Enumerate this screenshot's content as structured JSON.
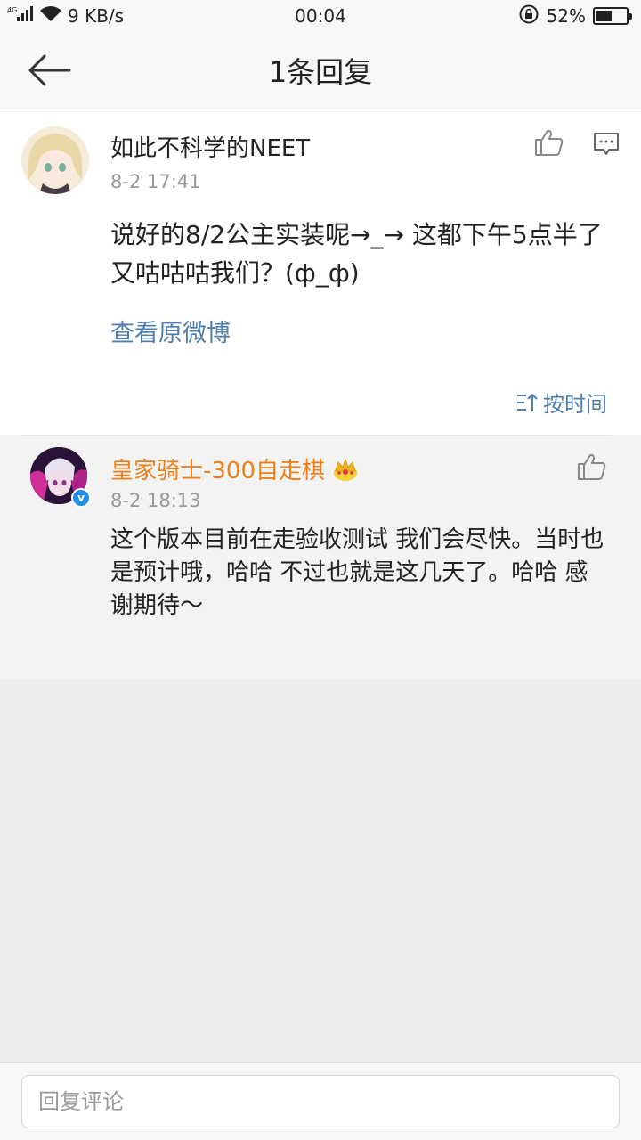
{
  "status_bar": {
    "network": "4G",
    "speed": "9 KB/s",
    "time": "00:04",
    "battery": "52%",
    "battery_level": 0.52
  },
  "header": {
    "title": "1条回复",
    "back_icon": "arrow-left-icon"
  },
  "comment": {
    "author": "如此不科学的NEET",
    "time": "8-2 17:41",
    "text": "说好的8/2公主实装呢→_→ 这都下午5点半了 又咕咕咕我们？(ф_ф)",
    "view_original": "查看原微博",
    "sort_label": "按时间",
    "icons": [
      "thumbs-up-icon",
      "comment-icon",
      "sort-icon"
    ]
  },
  "reply": {
    "author": "皇家骑士-300自走棋",
    "author_color": "#f07f1a",
    "badge_icon": "crown-icon",
    "verified_icon": "verified-icon",
    "time": "8-2 18:13",
    "text": "这个版本目前在走验收测试 我们会尽快。当时也是预计哦，哈哈 不过也就是这几天了。哈哈 感谢期待～"
  },
  "bottom_bar": {
    "input_placeholder": "回复评论"
  },
  "colors": {
    "link": "#507daf",
    "reply_bg": "#f3f3f3",
    "page_bg": "#eeeeee"
  }
}
